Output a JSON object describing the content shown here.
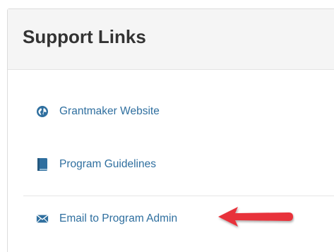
{
  "panel": {
    "title": "Support Links"
  },
  "links": [
    {
      "label": "Grantmaker Website",
      "icon": "globe-icon"
    },
    {
      "label": "Program Guidelines",
      "icon": "book-icon"
    },
    {
      "label": "Email to Program Admin",
      "icon": "envelope-icon"
    }
  ],
  "colors": {
    "link": "#2f6f9f",
    "icon": "#2f6f9f",
    "arrow": "#e8333a",
    "header_bg": "#f5f5f5",
    "title": "#333333"
  },
  "annotation": {
    "icon": "red-arrow-pointer"
  }
}
